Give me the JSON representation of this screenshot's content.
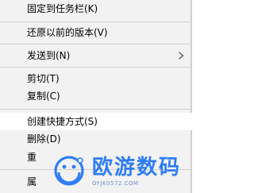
{
  "menu": {
    "items": [
      {
        "label": "固定到任务栏(K)"
      },
      {
        "label": "还原以前的版本(V)"
      },
      {
        "label": "发送到(N)"
      },
      {
        "label": "剪切(T)"
      },
      {
        "label": "复制(C)"
      },
      {
        "label": "创建快捷方式(S)"
      },
      {
        "label": "删除(D)"
      },
      {
        "label": "重"
      },
      {
        "label": "属"
      }
    ],
    "submenu_icon": "chevron-right-icon",
    "hovered_item": "创建快捷方式(S)"
  },
  "watermark": {
    "title": "欧游数码",
    "url": "OYJK0572.COM",
    "logo_icon": "smiley-logo-icon",
    "color": "#2f7df6"
  },
  "colors": {
    "menu_background": "#f2f2f2",
    "hover_background": "#ffffff",
    "separator": "#cfcfcf"
  }
}
